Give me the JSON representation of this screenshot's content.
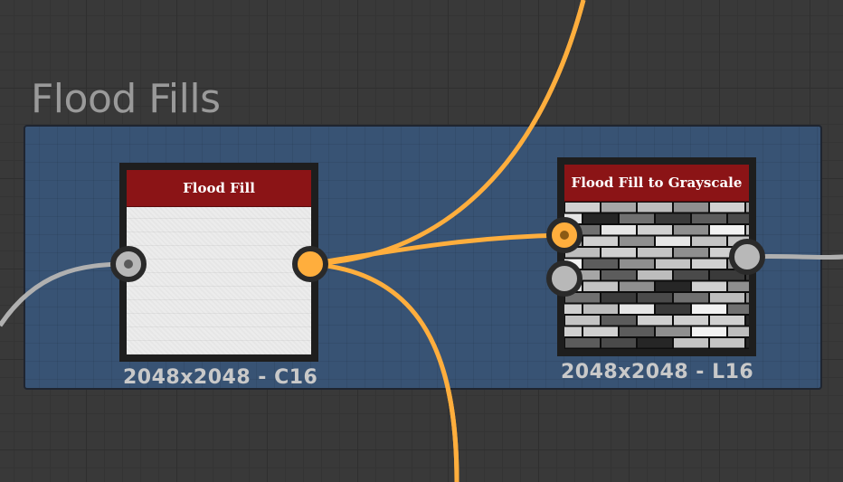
{
  "frame": {
    "title": "Flood Fills",
    "color": "#385374"
  },
  "nodes": [
    {
      "title": "Flood Fill",
      "caption": "2048x2048 - C16",
      "header_color": "#8b1416"
    },
    {
      "title": "Flood Fill to Grayscale",
      "caption": "2048x2048 - L16",
      "header_color": "#8b1416"
    }
  ],
  "wire_colors": {
    "color": "#ffae3d",
    "grayscale": "#b0b0b0"
  }
}
